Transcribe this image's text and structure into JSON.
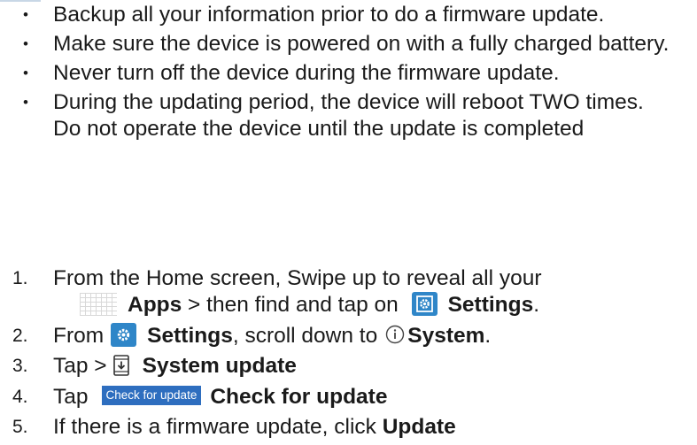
{
  "bullets": [
    "Backup all your information prior to do a firmware update.",
    "Make sure the device is powered on with a fully charged battery.",
    "Never turn off the device during the firmware update.",
    "During the updating period, the device will reboot TWO times. Do not operate the device until the update is completed"
  ],
  "bullet_symbol": "•",
  "steps": [
    {
      "num": "1.",
      "line1": "From the Home screen, Swipe up to reveal all your",
      "apps_label": "Apps",
      "apps_suffix": " > then find and tap on ",
      "settings_label": "Settings",
      "settings_suffix": "."
    },
    {
      "num": "2.",
      "prefix": "From",
      "settings_label": "Settings",
      "middle": ", scroll down to",
      "system_label": "System",
      "suffix": "."
    },
    {
      "num": "3.",
      "prefix": "Tap >",
      "label": "System update"
    },
    {
      "num": "4.",
      "prefix": "Tap",
      "button_label": "Check for update",
      "label": "Check for update"
    },
    {
      "num": "5.",
      "prefix": "If there is a firmware update, click ",
      "label": "Update"
    }
  ],
  "colors": {
    "settings_icon": "#2f86c8",
    "check_button": "#2e6ebf",
    "text": "#1a1a1a"
  },
  "icons": {
    "apps": "apps-grid-icon",
    "settings": "settings-gear-icon",
    "system": "info-circle-icon",
    "system_update": "system-update-icon"
  }
}
